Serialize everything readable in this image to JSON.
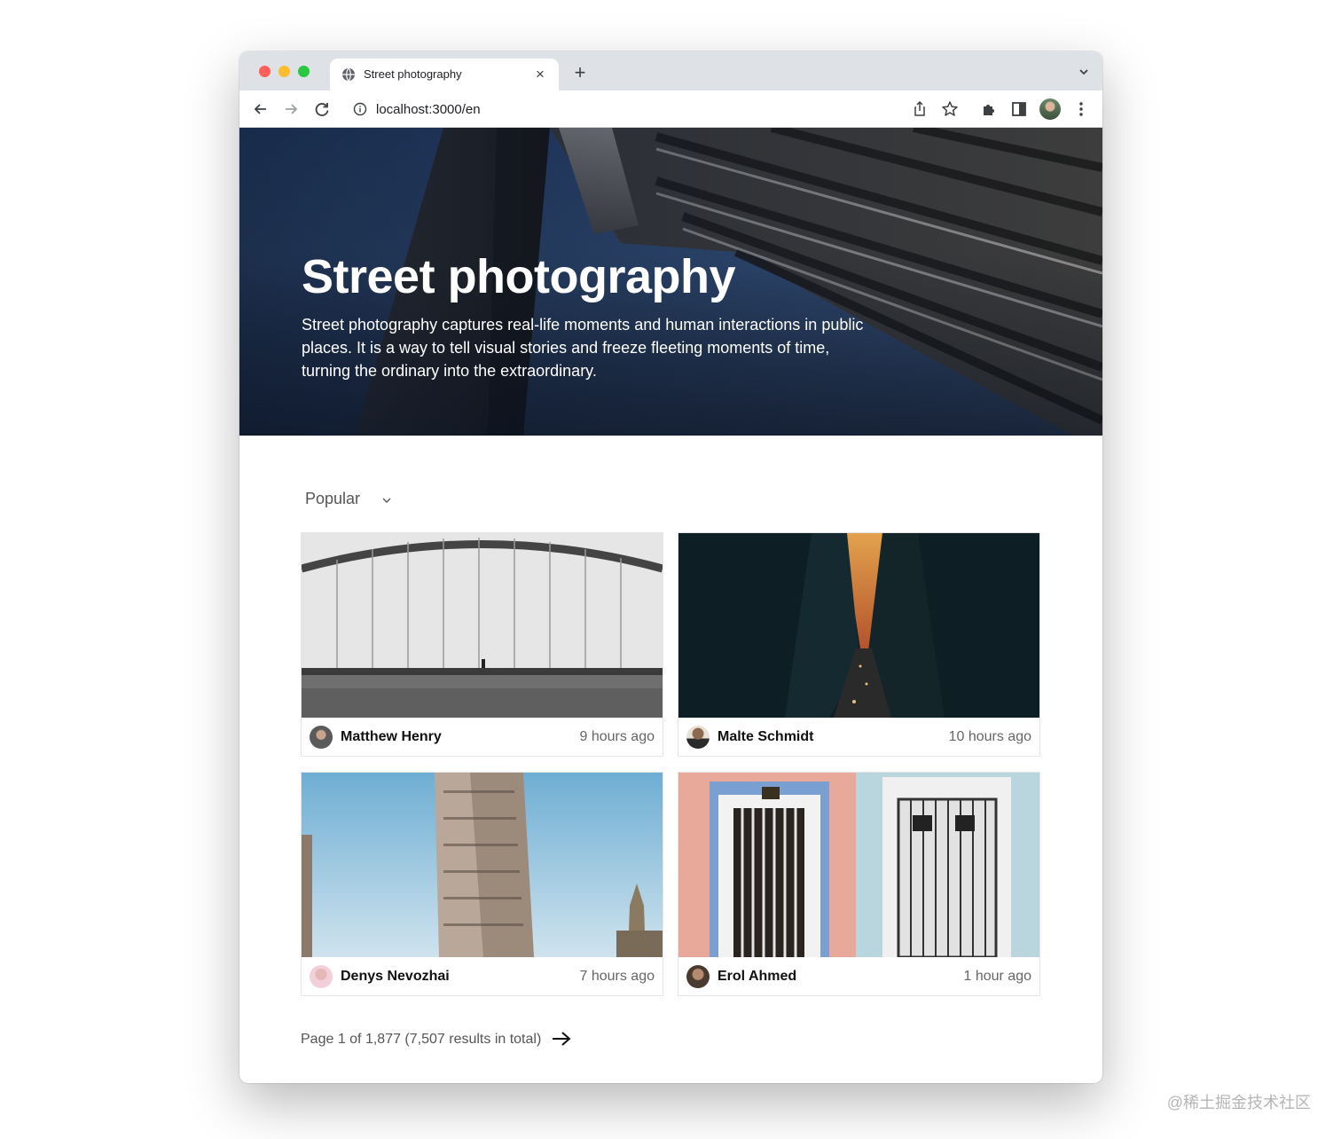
{
  "browser": {
    "tab_title": "Street photography",
    "tab_close": "×",
    "new_tab": "+",
    "url": "localhost:3000/en",
    "icons": [
      "globe-icon",
      "close-icon",
      "plus-icon",
      "chevron-down-icon",
      "back-arrow-icon",
      "forward-arrow-icon",
      "reload-icon",
      "info-icon",
      "share-icon",
      "star-icon",
      "extensions-icon",
      "side-panel-icon",
      "profile-avatar",
      "kebab-menu-icon"
    ]
  },
  "hero": {
    "title": "Street photography",
    "description": "Street photography captures real-life moments and human interactions in public places. It is a way to tell visual stories and freeze fleeting moments of time, turning the ordinary into the extraordinary."
  },
  "sort": {
    "selected": "Popular"
  },
  "photos": [
    {
      "author": "Matthew Henry",
      "time": "9 hours ago"
    },
    {
      "author": "Malte Schmidt",
      "time": "10 hours ago"
    },
    {
      "author": "Denys Nevozhai",
      "time": "7 hours ago"
    },
    {
      "author": "Erol Ahmed",
      "time": "1 hour ago"
    }
  ],
  "pagination": {
    "summary": "Page 1 of 1,877 (7,507 results in total)"
  },
  "watermark": "@稀土掘金技术社区",
  "colors": {
    "tab_strip": "#dee1e6",
    "close_red": "#ff5f57",
    "minimize_yellow": "#febc2e",
    "zoom_green": "#28c840"
  }
}
